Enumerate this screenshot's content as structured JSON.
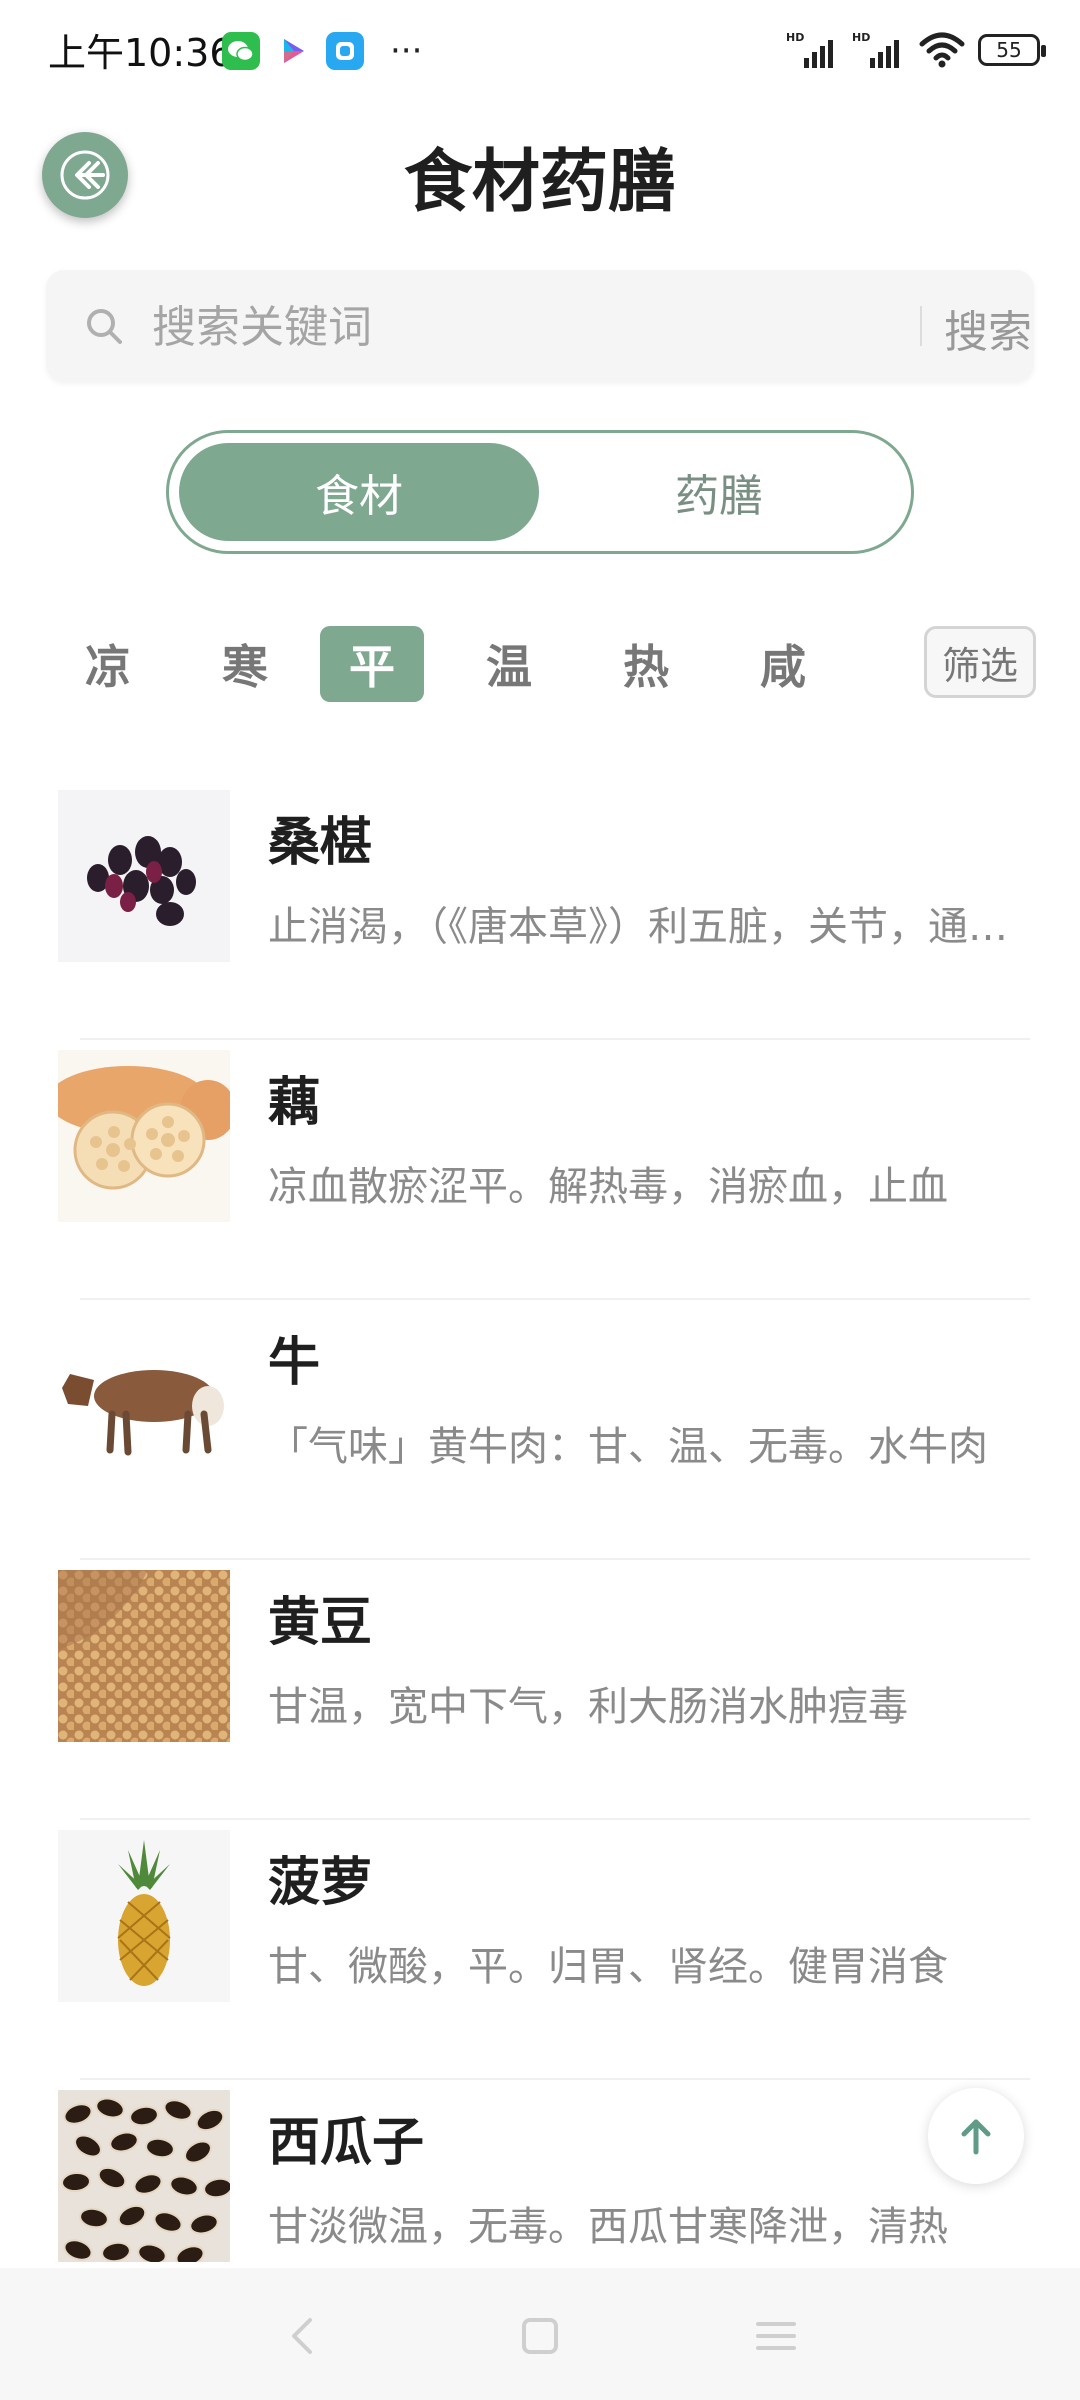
{
  "status_bar": {
    "time": "上午10:36",
    "battery": "55",
    "more": "···"
  },
  "header": {
    "title": "食材药膳"
  },
  "search": {
    "placeholder": "搜索关键词",
    "button_label": "搜索"
  },
  "tabs": [
    {
      "label": "食材",
      "active": true
    },
    {
      "label": "药膳",
      "active": false
    }
  ],
  "nature_filter": {
    "items": [
      "凉",
      "寒",
      "平",
      "温",
      "热",
      "咸"
    ],
    "selected": "平",
    "filter_label": "筛选"
  },
  "items": [
    {
      "name": "桑椹",
      "desc": "止消渴，（《唐本草》）利五脏，关节，通血气，久服不饥"
    },
    {
      "name": "藕",
      "desc": "凉血散瘀涩平。解热毒，消瘀血，止血"
    },
    {
      "name": "牛",
      "desc": "「气味」黄牛肉：甘、温、无毒。水牛肉"
    },
    {
      "name": "黄豆",
      "desc": "甘温，宽中下气，利大肠消水肿痘毒"
    },
    {
      "name": "菠萝",
      "desc": "甘、微酸，平。归胃、肾经。健胃消食"
    },
    {
      "name": "西瓜子",
      "desc": "甘淡微温，无毒。西瓜甘寒降泄，清热"
    }
  ],
  "colors": {
    "accent": "#7ea890",
    "title": "#1f1f1f",
    "desc": "#8a8a8a"
  }
}
